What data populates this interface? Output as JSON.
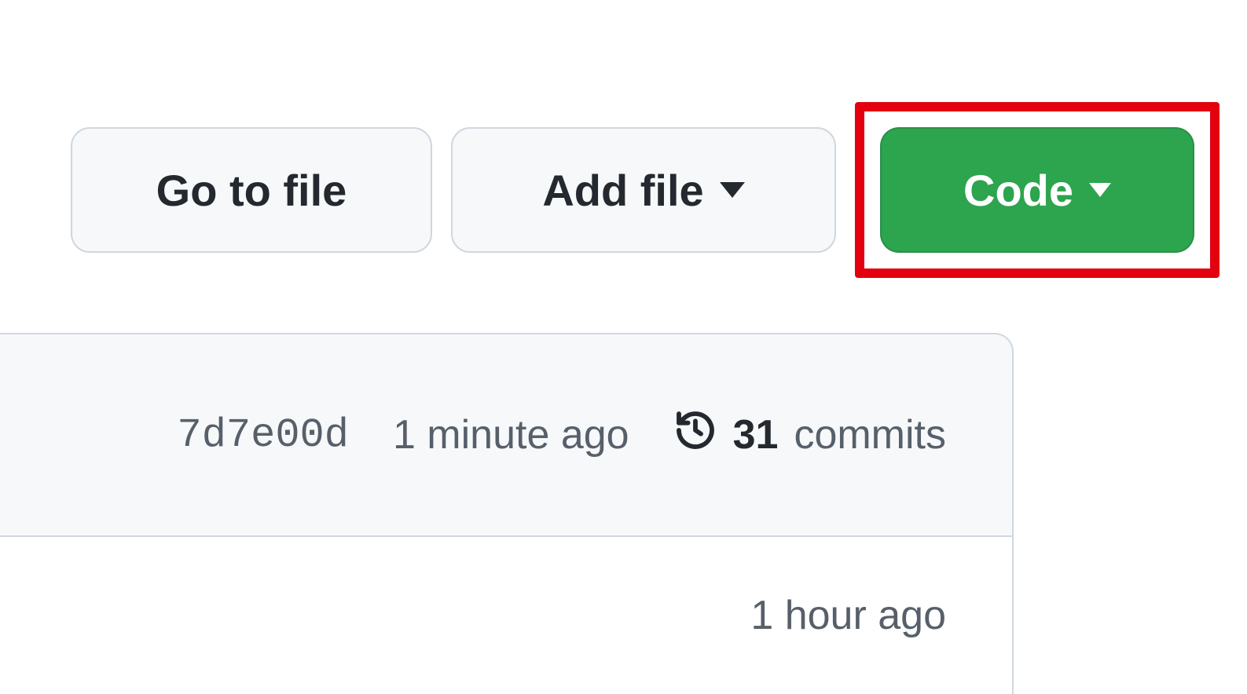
{
  "toolbar": {
    "go_to_file_label": "Go to file",
    "add_file_label": "Add file",
    "code_label": "Code"
  },
  "commit_info": {
    "hash": "7d7e00d",
    "time": "1 minute ago",
    "commits_count": "31",
    "commits_label": "commits"
  },
  "file_row": {
    "time": "1 hour ago"
  }
}
